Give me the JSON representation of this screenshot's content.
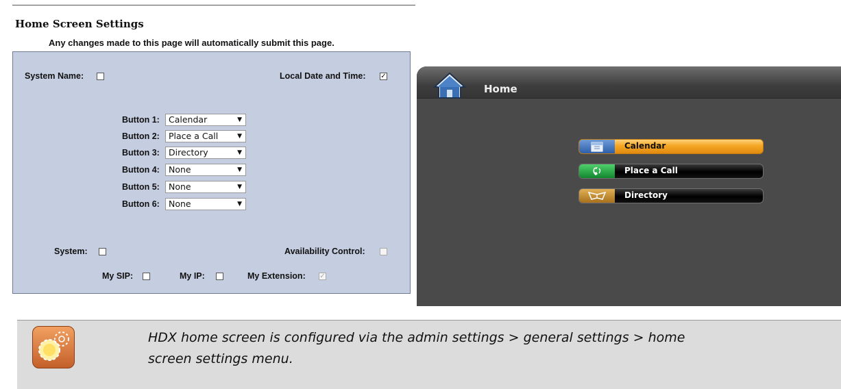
{
  "settings": {
    "title": "Home Screen Settings",
    "note": "Any changes made to this page will automatically submit this page.",
    "system_name": {
      "label": "System Name:",
      "checked": ""
    },
    "local_date_time": {
      "label": "Local Date and Time:",
      "checked": "✓"
    },
    "buttons": [
      {
        "label": "Button 1:",
        "value": "Calendar"
      },
      {
        "label": "Button 2:",
        "value": "Place a Call"
      },
      {
        "label": "Button 3:",
        "value": "Directory"
      },
      {
        "label": "Button 4:",
        "value": "None"
      },
      {
        "label": "Button 5:",
        "value": "None"
      },
      {
        "label": "Button 6:",
        "value": "None"
      }
    ],
    "dropdown_arrow": "▼",
    "system": {
      "label": "System:",
      "checked": ""
    },
    "availability_control": {
      "label": "Availability Control:",
      "checked": ""
    },
    "my_sip": {
      "label": "My SIP:",
      "checked": ""
    },
    "my_ip": {
      "label": "My IP:",
      "checked": ""
    },
    "my_extension": {
      "label": "My Extension:",
      "checked": "✓"
    }
  },
  "hdx": {
    "title": "Home",
    "buttons": [
      {
        "label": "Calendar",
        "icon": "calendar-icon",
        "color": "#3b6fb8"
      },
      {
        "label": "Place a Call",
        "icon": "phone-icon",
        "color": "#1f9a3a"
      },
      {
        "label": "Directory",
        "icon": "book-icon",
        "color": "#c68a2c"
      }
    ]
  },
  "tip": {
    "line1": "HDX home screen is configured via the admin settings > general settings > home",
    "line2": "screen settings menu.",
    "icon": "gears-icon"
  }
}
